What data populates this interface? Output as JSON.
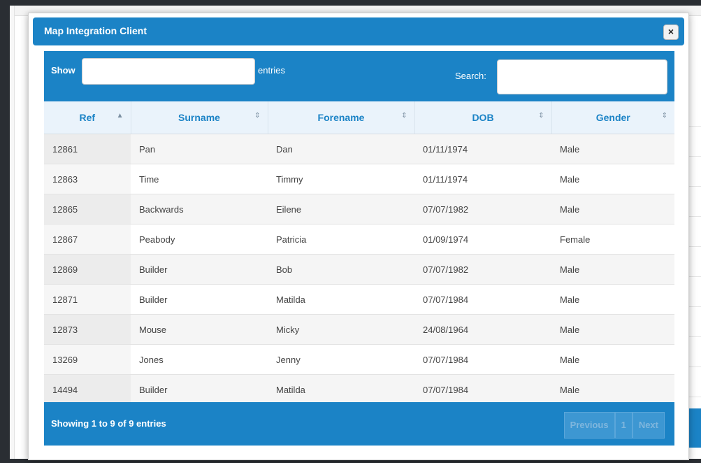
{
  "modal": {
    "title": "Map Integration Client",
    "close": "×"
  },
  "toolbar": {
    "show_label": "Show",
    "entries_label": "entries",
    "search_label": "Search:",
    "search_value": ""
  },
  "columns": [
    "Ref",
    "Surname",
    "Forename",
    "DOB",
    "Gender"
  ],
  "rows": [
    [
      "12861",
      "Pan",
      "Dan",
      "01/11/1974",
      "Male"
    ],
    [
      "12863",
      "Time",
      "Timmy",
      "01/11/1974",
      "Male"
    ],
    [
      "12865",
      "Backwards",
      "Eilene",
      "07/07/1982",
      "Male"
    ],
    [
      "12867",
      "Peabody",
      "Patricia",
      "01/09/1974",
      "Female"
    ],
    [
      "12869",
      "Builder",
      "Bob",
      "07/07/1982",
      "Male"
    ],
    [
      "12871",
      "Builder",
      "Matilda",
      "07/07/1984",
      "Male"
    ],
    [
      "12873",
      "Mouse",
      "Micky",
      "24/08/1964",
      "Male"
    ],
    [
      "13269",
      "Jones",
      "Jenny",
      "07/07/1984",
      "Male"
    ],
    [
      "14494",
      "Builder",
      "Matilda",
      "07/07/1984",
      "Male"
    ]
  ],
  "footer": {
    "info": "Showing 1 to 9 of 9 entries",
    "previous": "Previous",
    "page": "1",
    "next": "Next"
  },
  "colors": {
    "accent": "#1b83c6",
    "header_row": "#eaf3fb"
  }
}
